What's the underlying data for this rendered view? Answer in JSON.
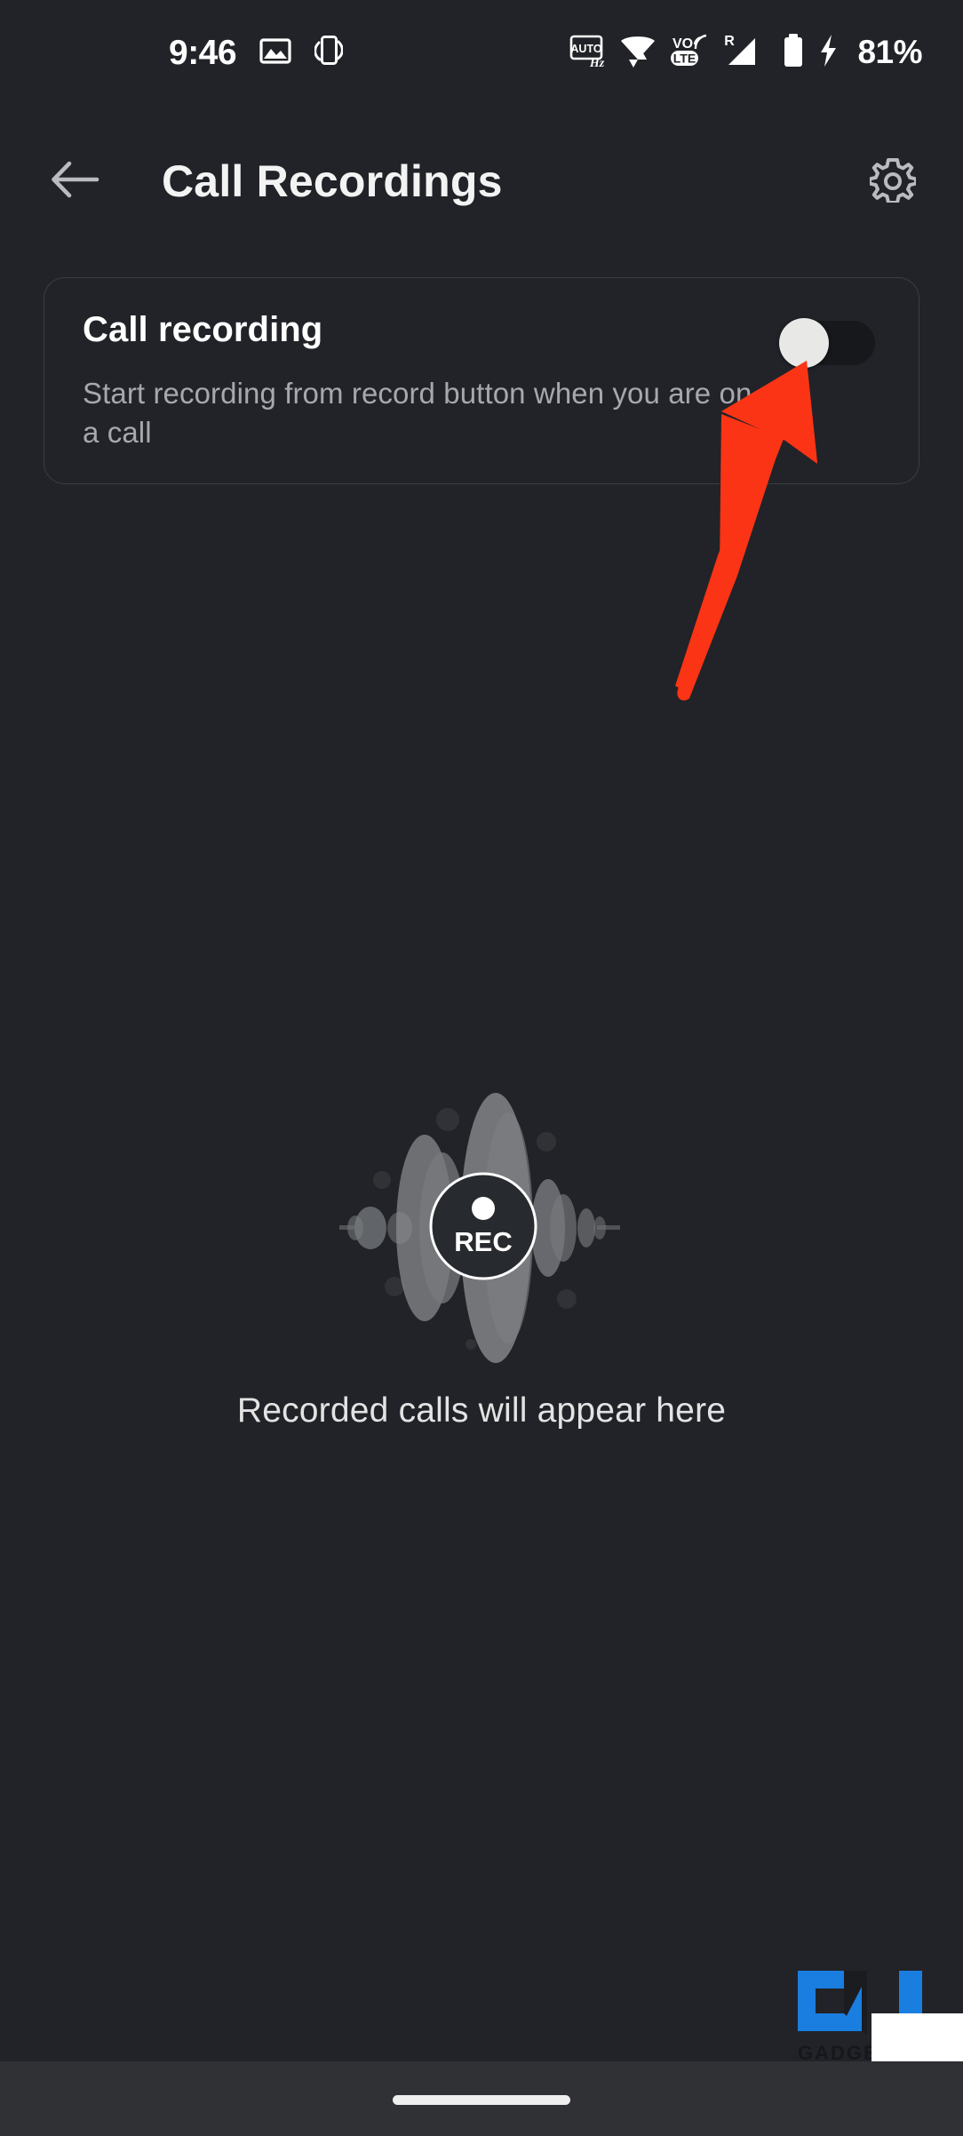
{
  "status_bar": {
    "time": "9:46",
    "battery_percent": "81%",
    "left_icons": [
      "image-icon",
      "screen-rotation-icon"
    ],
    "right_icons": [
      "auto-hz-icon",
      "wifi-icon",
      "volte-icon",
      "roaming-signal-icon",
      "battery-icon",
      "charging-bolt-icon"
    ]
  },
  "app_bar": {
    "back_label": "back-arrow",
    "title": "Call Recordings",
    "settings_label": "settings-gear"
  },
  "setting_card": {
    "title": "Call recording",
    "description": "Start recording from record button when you are on a call",
    "toggle": {
      "name": "call-recording-toggle",
      "state": "off",
      "thumb_color": "#e8e8e6",
      "track_color": "#17181b"
    }
  },
  "annotation": {
    "type": "arrow",
    "color": "#fa3415",
    "points_to": "call-recording-toggle"
  },
  "empty_state": {
    "illustration": "rec-waveform-icon",
    "rec_label": "REC",
    "message": "Recorded calls will appear here"
  },
  "watermark": {
    "brand": "GADGETS",
    "accent_color": "#1a7ee0"
  },
  "nav_bar": {
    "gesture_pill": "home-gesture-pill"
  },
  "colors": {
    "background": "#212328",
    "card_border": "#3a3d42",
    "primary_text": "#ffffff",
    "secondary_text": "#a6a8ad",
    "nav_bar_bg": "#2f3135"
  }
}
